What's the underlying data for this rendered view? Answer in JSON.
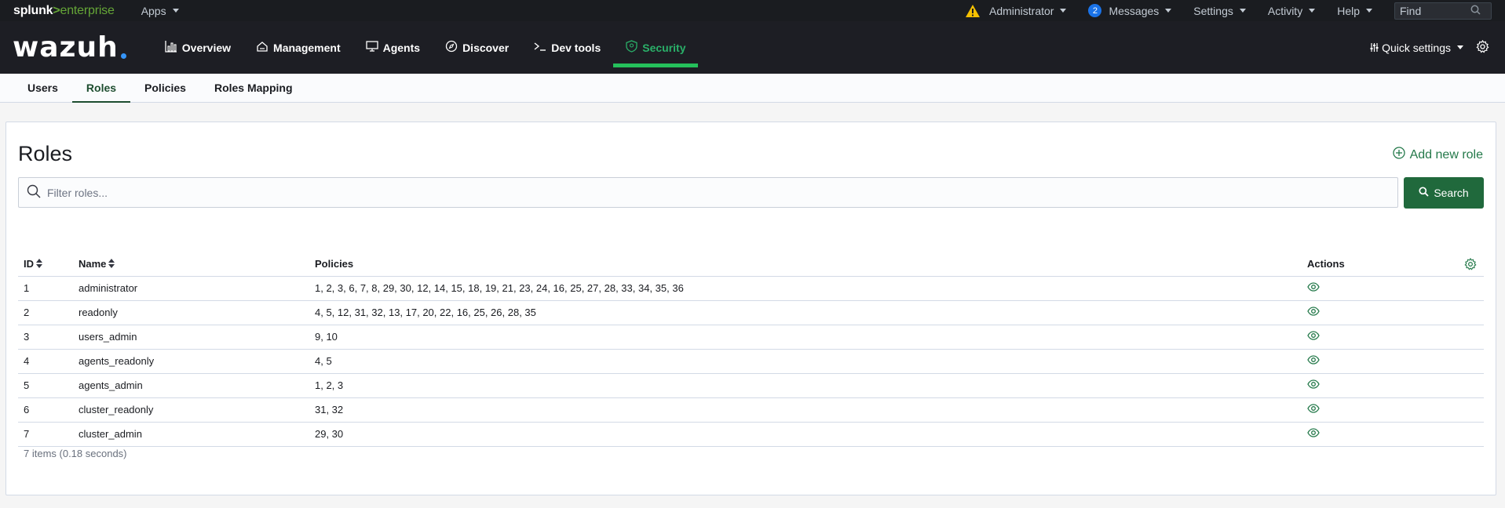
{
  "splunk": {
    "logo_main": "splunk",
    "logo_gt": ">",
    "logo_ent": "enterprise",
    "apps": "Apps",
    "user": "Administrator",
    "messages_count": "2",
    "messages": "Messages",
    "settings": "Settings",
    "activity": "Activity",
    "help": "Help",
    "find_placeholder": "Find"
  },
  "wazuh": {
    "logo": "wazuh",
    "nav": [
      {
        "label": "Overview",
        "icon": "chart-icon"
      },
      {
        "label": "Management",
        "icon": "cloud-icon"
      },
      {
        "label": "Agents",
        "icon": "monitor-icon"
      },
      {
        "label": "Discover",
        "icon": "compass-icon"
      },
      {
        "label": "Dev tools",
        "icon": "terminal-icon"
      },
      {
        "label": "Security",
        "icon": "shield-icon"
      }
    ],
    "active_nav": "Security",
    "quick_settings": "Quick settings"
  },
  "tabs": [
    {
      "label": "Users"
    },
    {
      "label": "Roles"
    },
    {
      "label": "Policies"
    },
    {
      "label": "Roles Mapping"
    }
  ],
  "active_tab": "Roles",
  "panel": {
    "title": "Roles",
    "add_label": "Add new role",
    "filter_placeholder": "Filter roles...",
    "search_label": "Search"
  },
  "table": {
    "headers": {
      "id": "ID",
      "name": "Name",
      "policies": "Policies",
      "actions": "Actions"
    },
    "rows": [
      {
        "id": "1",
        "name": "administrator",
        "policies": "1, 2, 3, 6, 7, 8, 29, 30, 12, 14, 15, 18, 19, 21, 23, 24, 16, 25, 27, 28, 33, 34, 35, 36"
      },
      {
        "id": "2",
        "name": "readonly",
        "policies": "4, 5, 12, 31, 32, 13, 17, 20, 22, 16, 25, 26, 28, 35"
      },
      {
        "id": "3",
        "name": "users_admin",
        "policies": "9, 10"
      },
      {
        "id": "4",
        "name": "agents_readonly",
        "policies": "4, 5"
      },
      {
        "id": "5",
        "name": "agents_admin",
        "policies": "1, 2, 3"
      },
      {
        "id": "6",
        "name": "cluster_readonly",
        "policies": "31, 32"
      },
      {
        "id": "7",
        "name": "cluster_admin",
        "policies": "29, 30"
      }
    ],
    "footer": "7 items (0.18 seconds)"
  },
  "colors": {
    "accent_green": "#24794a",
    "nav_active": "#25c05b",
    "search_button": "#20693c",
    "header_bg": "#1d1e24"
  }
}
